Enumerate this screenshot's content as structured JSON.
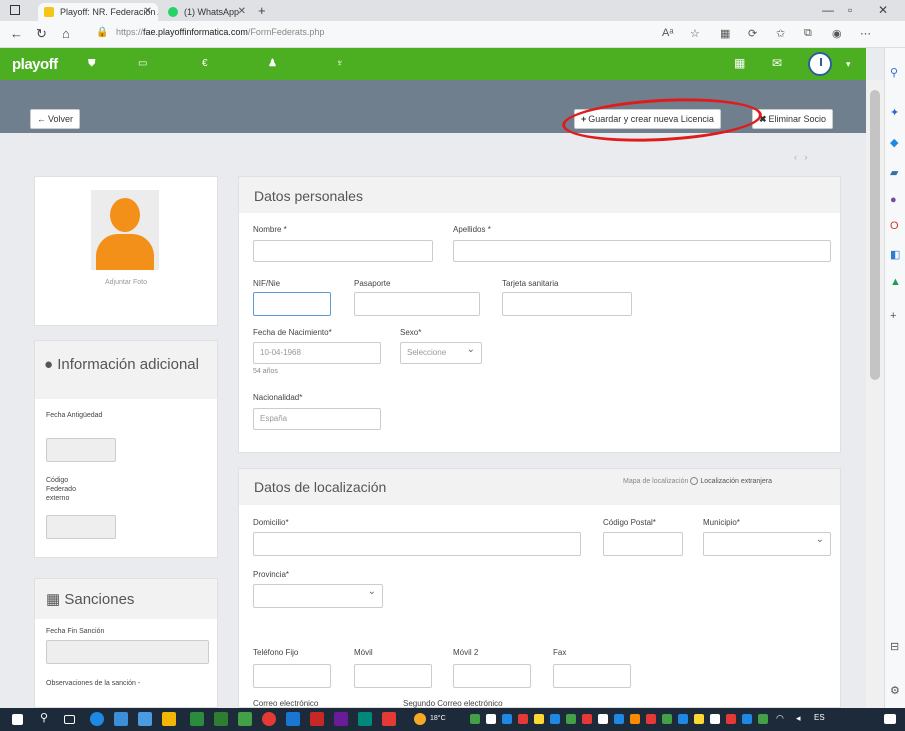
{
  "browser": {
    "tabs": [
      {
        "label": "Playoff: NR. Federación Andalu...",
        "active": true
      },
      {
        "label": "(1) WhatsApp",
        "active": false
      }
    ],
    "url_prefix": "https://",
    "url_domain": "fae.playoffinformatica.com",
    "url_path": "/FormFederats.php"
  },
  "appnav": {
    "logo": "playoff",
    "items": [
      {
        "label": "",
        "icon": "shield-icon"
      },
      {
        "label": "",
        "icon": "id-card-icon"
      },
      {
        "label": "",
        "icon": "euro-icon"
      },
      {
        "label": "",
        "icon": "person-icon",
        "active": true
      },
      {
        "label": "",
        "icon": "trophy-icon"
      },
      {
        "label": "",
        "icon": "text-icon"
      }
    ]
  },
  "toolbar": {
    "back_label": "Volver",
    "save_label": "Guardar y crear nueva Licencia",
    "delete_label": "Eliminar Socio"
  },
  "breadcrumb": "",
  "left": {
    "attach_photo": "Adjuntar Foto",
    "info_title": "Información adicional",
    "fecha_antiguedad": "Fecha Antigüedad",
    "codigo_federado": "Código Federado externo",
    "sanciones_title": "Sanciones",
    "fecha_fin_sancion": "Fecha Fin Sanción",
    "observaciones_sancion": "Observaciones de la sanción -"
  },
  "personal": {
    "title": "Datos personales",
    "nombre": "Nombre *",
    "apellidos": "Apellidos *",
    "nif": "NIF/Nie",
    "pasaporte": "Pasaporte",
    "tarjeta": "Tarjeta sanitaria",
    "fecha_nac": "Fecha de Nacimiento*",
    "fecha_nac_value": "10-04-1968",
    "edad": "54 años",
    "sexo": "Sexo*",
    "sexo_value": "Seleccione",
    "nacionalidad": "Nacionalidad*",
    "nacionalidad_value": "España"
  },
  "location": {
    "title": "Datos de localización",
    "mapa": "Mapa de localización",
    "extranjera": "Localización extranjera",
    "domicilio": "Domicilio*",
    "codigo_postal": "Código Postal*",
    "municipio": "Municipio*",
    "provincia": "Provincia*",
    "telefono": "Teléfono Fijo",
    "movil": "Móvil",
    "movil2": "Móvil 2",
    "fax": "Fax",
    "correo": "Correo electrónico",
    "correo2": "Segundo Correo electrónico"
  },
  "taskbar": {
    "temp": "18°C",
    "time": "",
    "date": ""
  },
  "colors": {
    "nav_green": "#4caf22",
    "toolbar_gray": "#707f8e",
    "annotation_red": "#e01b1b",
    "avatar_orange": "#f39019"
  }
}
